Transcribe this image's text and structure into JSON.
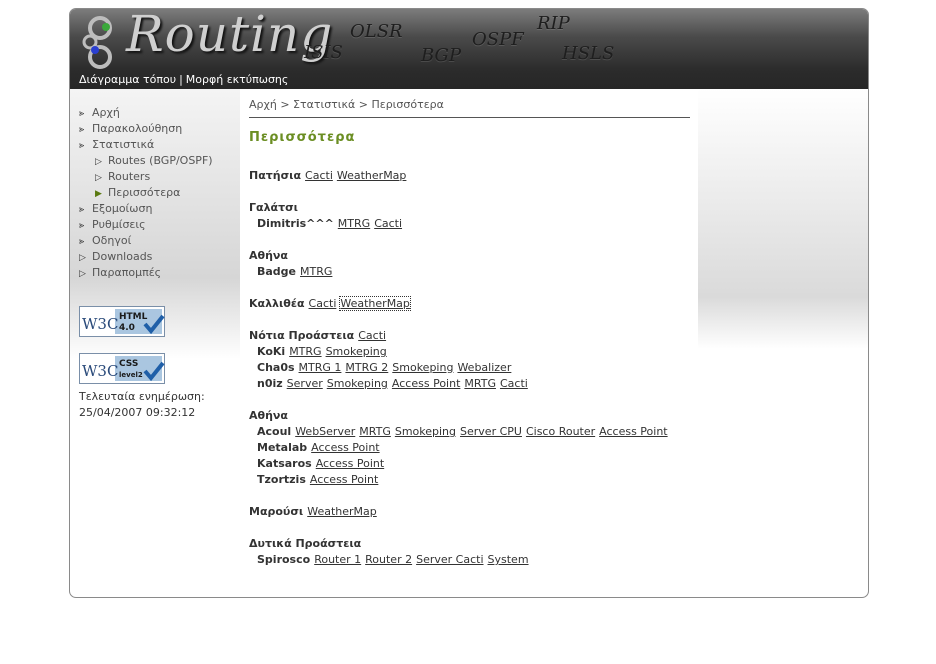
{
  "header": {
    "logo_text": "Routing",
    "protocols": [
      "OLSR",
      "RIP",
      "ISIS",
      "BGP",
      "OSPF",
      "HSLS"
    ],
    "topnav": {
      "sitemap": "Διάγραμμα τόπου",
      "separator": "|",
      "print": "Μορφή εκτύπωσης"
    }
  },
  "sidebar": {
    "items": [
      {
        "label": "Αρχή",
        "level": 0
      },
      {
        "label": "Παρακολούθηση",
        "level": 0
      },
      {
        "label": "Στατιστικά",
        "level": 0
      },
      {
        "label": "Routes (BGP/OSPF)",
        "level": 1
      },
      {
        "label": "Routers",
        "level": 1
      },
      {
        "label": "Περισσότερα",
        "level": 1,
        "active": true
      },
      {
        "label": "Εξομοίωση",
        "level": 0
      },
      {
        "label": "Ρυθμίσεις",
        "level": 0
      },
      {
        "label": "Οδηγοί",
        "level": 0
      },
      {
        "label": "Downloads",
        "level": 0
      },
      {
        "label": "Παραπομπές",
        "level": 0
      }
    ],
    "badges": {
      "html": {
        "w3c": "W3C",
        "title": "HTML",
        "version": "4.0"
      },
      "css": {
        "w3c": "W3C",
        "title": "CSS",
        "version": "level2"
      }
    },
    "updated_label": "Τελευταία ενημέρωση:",
    "updated_value": "25/04/2007 09:32:12"
  },
  "breadcrumb": "Αρχή > Στατιστικά > Περισσότερα",
  "title": "Περισσότερα",
  "rows": [
    {
      "name": "Πατήσια",
      "links": [
        "Cacti",
        "WeatherMap"
      ]
    },
    {
      "name": "Γαλάτσι",
      "links": []
    },
    {
      "name": "Dimitris^^^",
      "links": [
        "MTRG",
        "Cacti"
      ],
      "indent": true
    },
    {
      "name": "Αθήνα",
      "links": []
    },
    {
      "name": "Badge",
      "links": [
        "MTRG"
      ],
      "indent": true
    },
    {
      "name": "Καλλιθέα",
      "links": [
        "Cacti",
        "WeatherMap"
      ]
    },
    {
      "name": "Νότια Προάστεια",
      "links": [
        "Cacti"
      ]
    },
    {
      "name": "KoKi",
      "links": [
        "MTRG",
        "Smokeping"
      ],
      "indent": true
    },
    {
      "name": "Cha0s",
      "links": [
        "MTRG 1",
        "MTRG 2",
        "Smokeping",
        "Webalizer"
      ],
      "indent": true
    },
    {
      "name": "n0iz",
      "links": [
        "Server",
        "Smokeping",
        "Access Point",
        "MRTG",
        "Cacti"
      ],
      "indent": true
    },
    {
      "name": "Αθήνα",
      "links": []
    },
    {
      "name": "Acoul",
      "links": [
        "WebServer",
        "MRTG",
        "Smokeping",
        "Server CPU",
        "Cisco Router",
        "Access Point"
      ],
      "indent": true
    },
    {
      "name": "Metalab",
      "links": [
        "Access Point"
      ],
      "indent": true
    },
    {
      "name": "Katsaros",
      "links": [
        "Access Point"
      ],
      "indent": true
    },
    {
      "name": "Tzortzis",
      "links": [
        "Access Point"
      ],
      "indent": true
    },
    {
      "name": "Μαρούσι",
      "links": [
        "WeatherMap"
      ]
    },
    {
      "name": "Δυτικά Προάστεια",
      "links": []
    },
    {
      "name": "Spirosco",
      "links": [
        "Router 1",
        "Router 2",
        "Server Cacti",
        "System"
      ],
      "indent": true
    }
  ],
  "colors": {
    "accent": "#6b8e23",
    "header_dark": "#2c2c2c",
    "badge_blue": "#3d7ab8"
  }
}
